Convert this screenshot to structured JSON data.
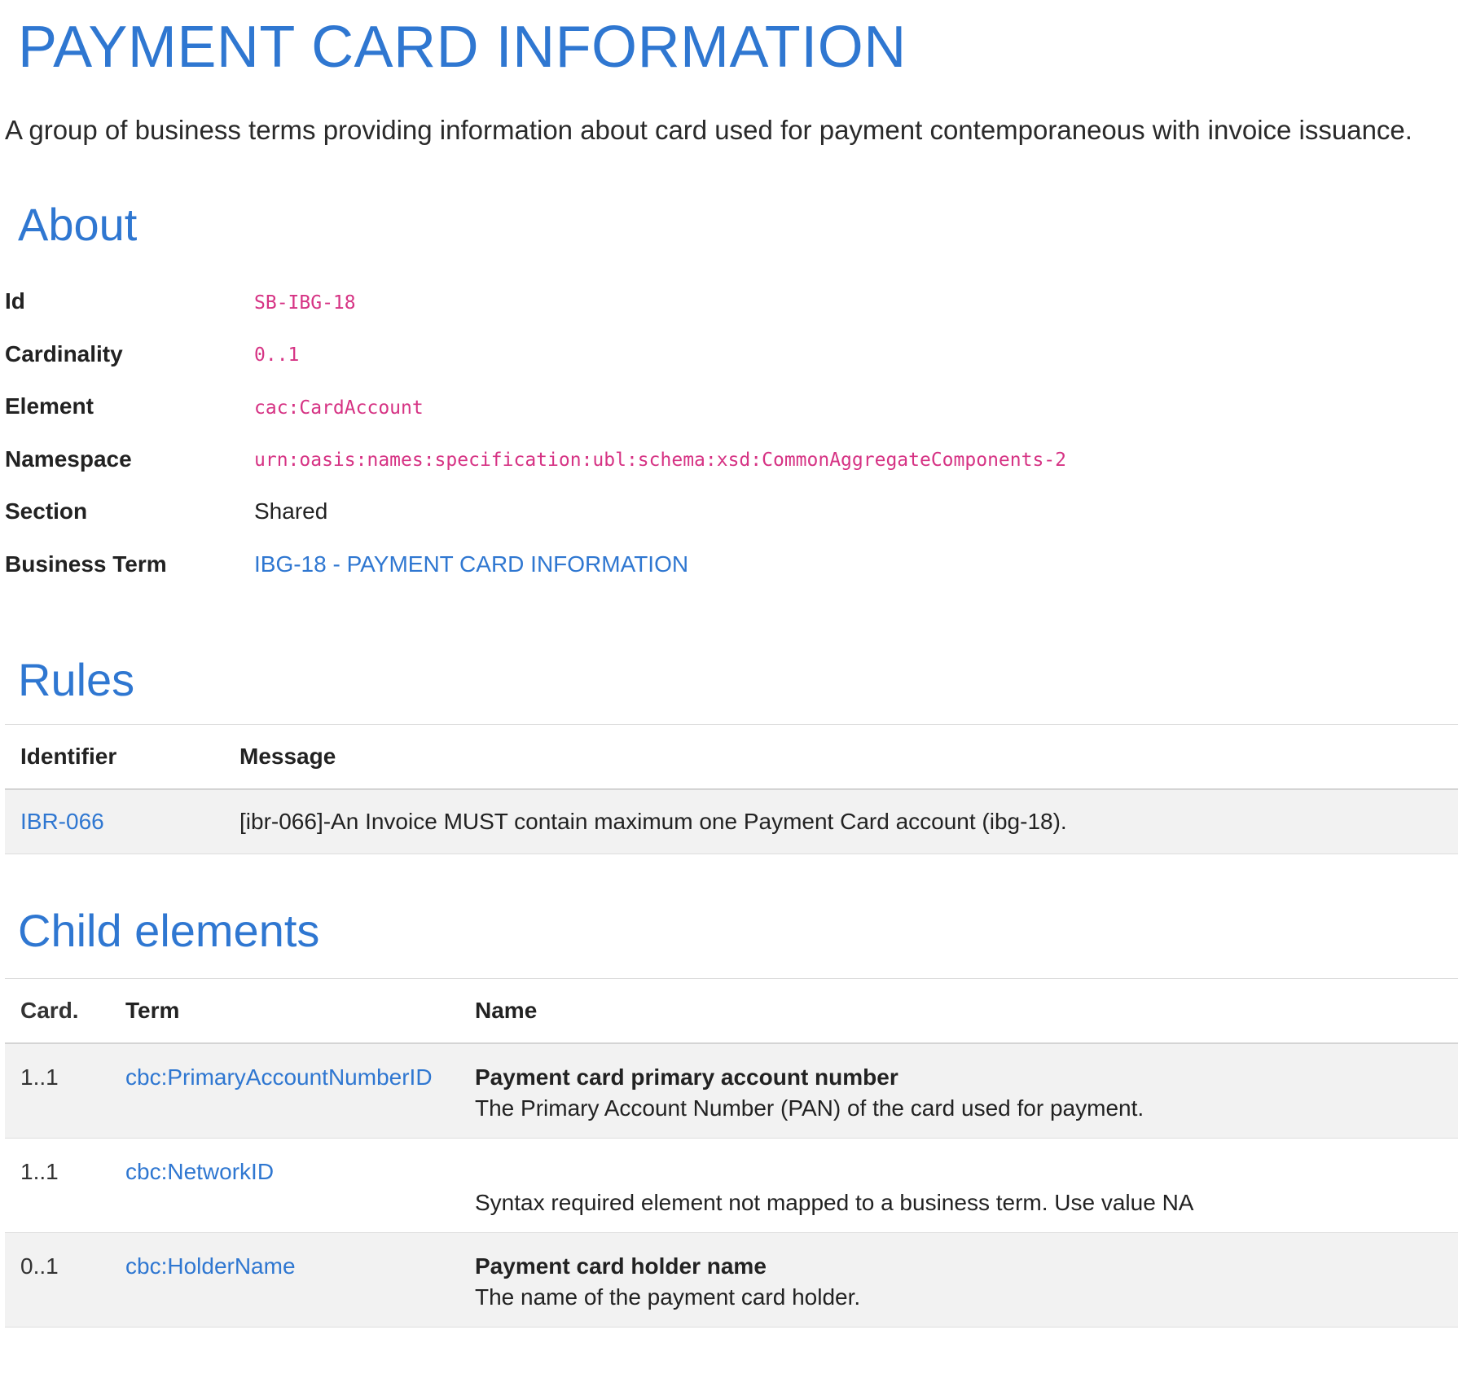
{
  "title": "PAYMENT CARD INFORMATION",
  "description": "A group of business terms providing information about card used for payment contemporaneous with invoice issuance.",
  "about": {
    "heading": "About",
    "rows": [
      {
        "label": "Id",
        "value": "SB-IBG-18",
        "kind": "code"
      },
      {
        "label": "Cardinality",
        "value": "0..1",
        "kind": "code"
      },
      {
        "label": "Element",
        "value": "cac:CardAccount",
        "kind": "code"
      },
      {
        "label": "Namespace",
        "value": "urn:oasis:names:specification:ubl:schema:xsd:CommonAggregateComponents-2",
        "kind": "code"
      },
      {
        "label": "Section",
        "value": "Shared",
        "kind": "plain"
      },
      {
        "label": "Business Term",
        "value": "IBG-18 - PAYMENT CARD INFORMATION",
        "kind": "link"
      }
    ]
  },
  "rules": {
    "heading": "Rules",
    "columns": [
      "Identifier",
      "Message"
    ],
    "rows": [
      {
        "identifier": "IBR-066",
        "message": "[ibr-066]-An Invoice MUST contain maximum one Payment Card account (ibg-18)."
      }
    ]
  },
  "child_elements": {
    "heading": "Child elements",
    "columns": [
      "Card.",
      "Term",
      "Name"
    ],
    "rows": [
      {
        "card": "1..1",
        "term": "cbc:PrimaryAccountNumberID",
        "name": "Payment card primary account number",
        "description": "The Primary Account Number (PAN) of the card used for payment."
      },
      {
        "card": "1..1",
        "term": "cbc:NetworkID",
        "name": "",
        "description": "Syntax required element not mapped to a business term. Use value NA"
      },
      {
        "card": "0..1",
        "term": "cbc:HolderName",
        "name": "Payment card holder name",
        "description": "The name of the payment card holder."
      }
    ]
  },
  "colors": {
    "heading_blue": "#2f77d1",
    "code_pink": "#d63384",
    "stripe_gray": "#f2f2f2"
  }
}
